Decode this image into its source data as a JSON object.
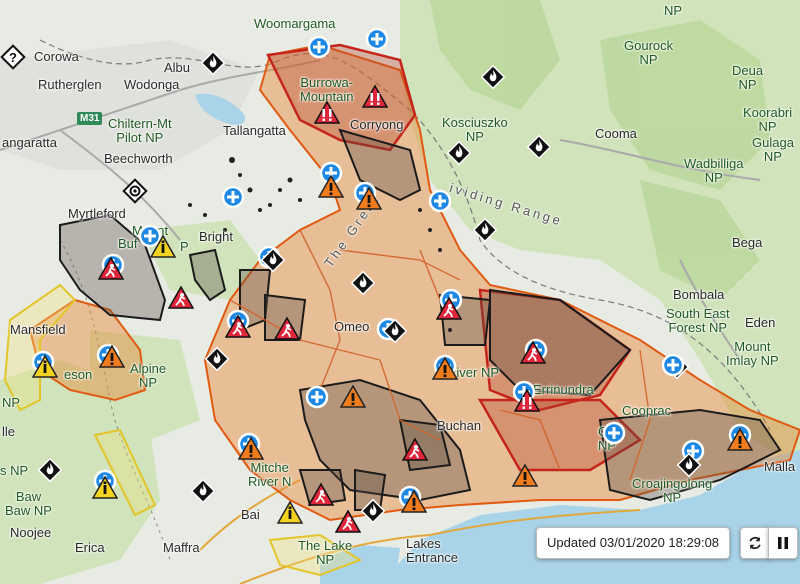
{
  "status": {
    "updated": "Updated 03/01/2020 18:29:08"
  },
  "controls": {
    "refresh_icon": "refresh-icon",
    "pause_icon": "pause-icon"
  },
  "roads": [
    {
      "name": "M31"
    }
  ],
  "labels": {
    "corowa": "Corowa",
    "rutherglen": "Rutherglen",
    "wodonga": "Wodonga",
    "albury": "Albu",
    "wangaratta": "angaratta",
    "chiltern": "Chiltern-Mt",
    "chiltern2": "Pilot NP",
    "tallangatta": "Tallangatta",
    "beechworth": "Beechworth",
    "myrtleford": "Myrtleford",
    "buffalo": "Buf",
    "mount": "Mount",
    "bright": "Bright",
    "mansfield": "Mansfield",
    "woomargama": "Woomargama",
    "burrowa": "Burrowa-",
    "burrowa2": "Mountain",
    "corryong": "Corryong",
    "kosciuszko": "Kosciuszko",
    "kosciuszko2": "NP",
    "gourock": "Gourock",
    "gourock2": "NP",
    "deua": "Deua",
    "deua2": "NP",
    "cooma": "Cooma",
    "koorabri": "Koorabri",
    "koorabri2": "NP",
    "gulaga": "Gulaga",
    "gulaga2": "NP",
    "wadbilliga": "Wadbilliga",
    "wadbilliga2": "NP",
    "bega": "Bega",
    "bombala": "Bombala",
    "southeast": "South East",
    "southeast2": "Forest NP",
    "eden": "Eden",
    "mountimlay": "Mount",
    "mountimlay2": "Imlay NP",
    "greatdividing": "ividing Range",
    "thegreat": "The Great",
    "omeo": "Omeo",
    "alpine": "Alpine",
    "alpine2": "NP",
    "jeson": "eson",
    "snowy": "River NP",
    "errinundra": "Errinundra",
    "buchan": "Buchan",
    "cooprac": "Cooprac",
    "cooprac2": "NP",
    "croajingolong": "Croajingolong",
    "croajingolong2": "NP",
    "mallacoota": "Malla",
    "mitchell": "Mitche",
    "mitchell2": "River N",
    "bairnsdale": "Bai",
    "thelakes": "The Lake",
    "thelakes2": "NP",
    "lakesentrance": "Lakes",
    "lakesentrance2": "Entrance",
    "maffra": "Maffra",
    "erica": "Erica",
    "noojee": "Noojee",
    "baw": "Baw",
    "baw2": "Baw NP",
    "np_left": "NP",
    "np_left2": "s NP",
    "lle": "lle",
    "bp": "P",
    "cr": "C",
    "top_np": "NP"
  }
}
